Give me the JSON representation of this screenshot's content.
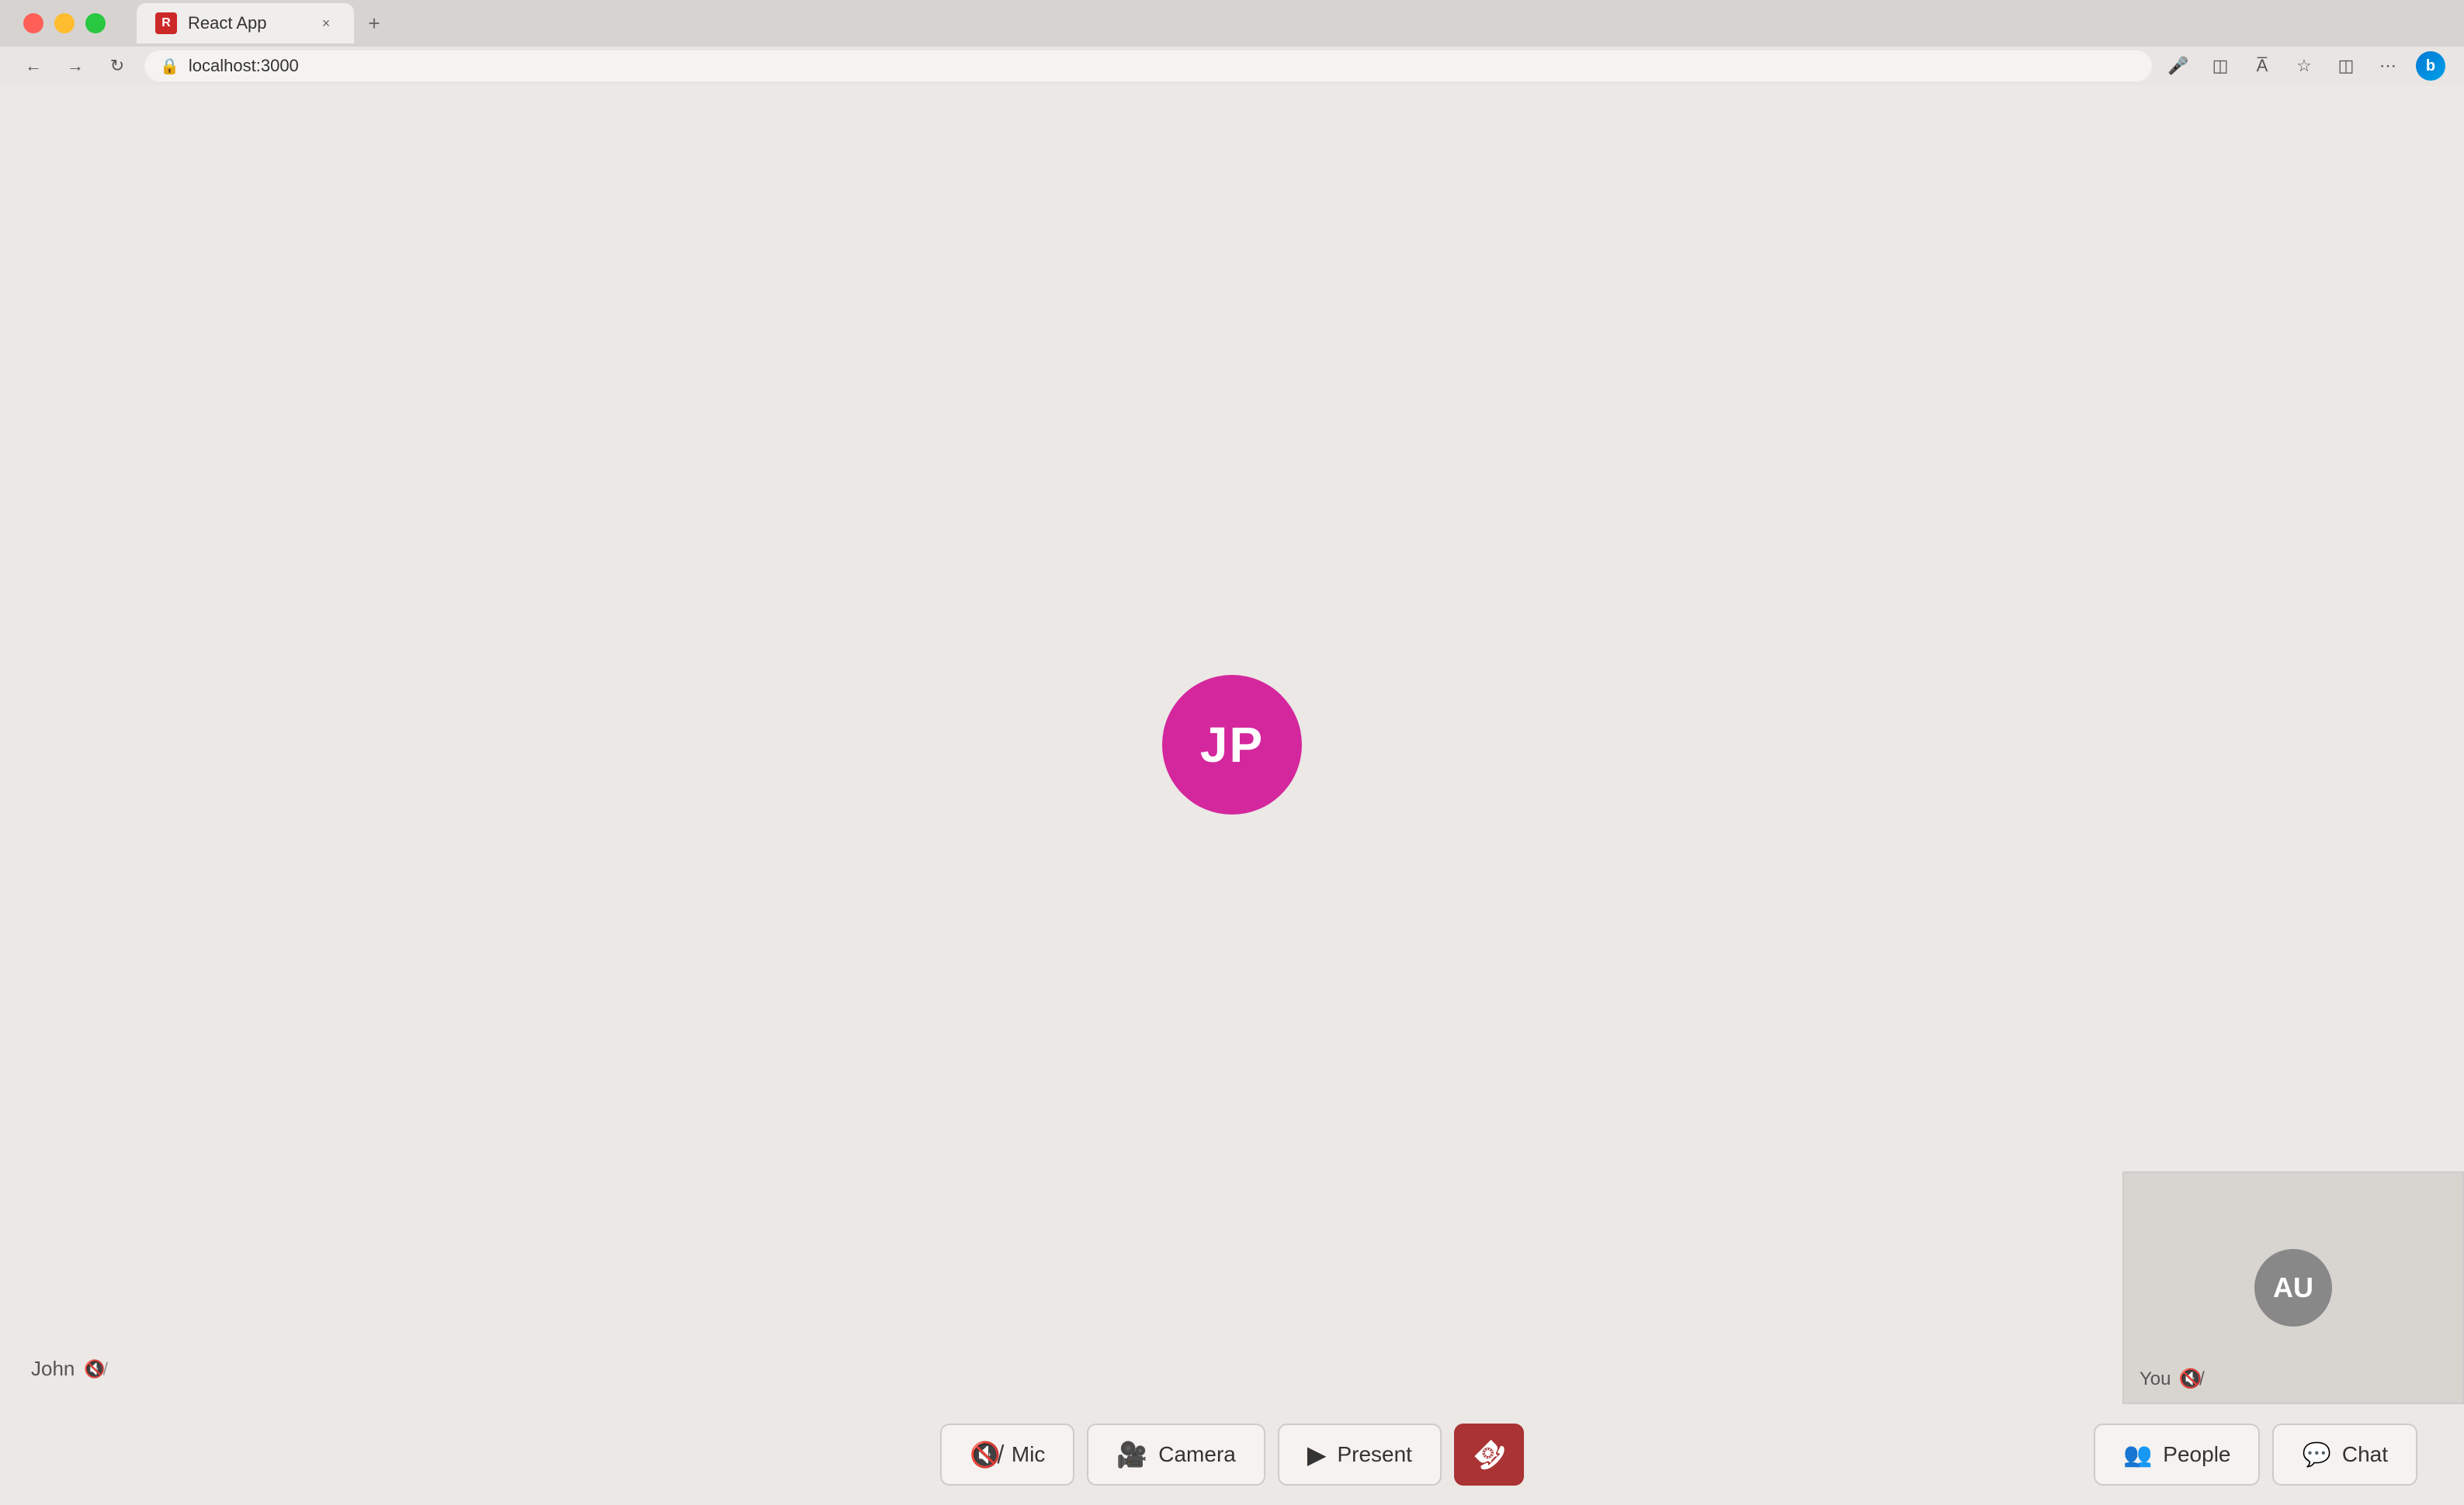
{
  "browser": {
    "tab_title": "React App",
    "tab_favicon_letter": "R",
    "address": "localhost:3000",
    "close_tab_label": "×",
    "new_tab_label": "+"
  },
  "main_participant": {
    "initials": "JP",
    "avatar_color": "#d4279e",
    "name": "John"
  },
  "self_view": {
    "initials": "AU",
    "label": "You"
  },
  "controls": {
    "mic_label": "Mic",
    "camera_label": "Camera",
    "present_label": "Present",
    "people_label": "People",
    "chat_label": "Chat"
  }
}
